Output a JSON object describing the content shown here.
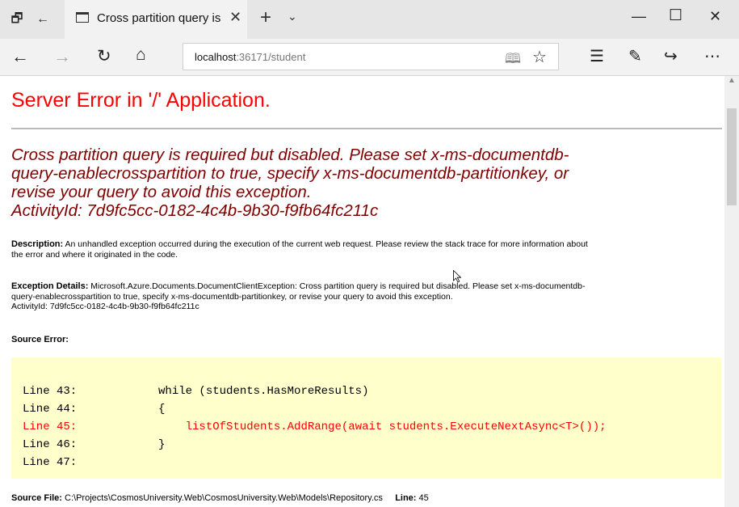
{
  "browser": {
    "tab_title": "Cross partition query is",
    "address_host": "localhost",
    "address_path": ":36171/student"
  },
  "page": {
    "title": "Server Error in '/' Application.",
    "error_heading_lines": [
      "Cross partition query is required but disabled. Please set x-ms-documentdb-",
      "query-enablecrosspartition to true, specify x-ms-documentdb-partitionkey, or",
      "revise your query to avoid this exception.",
      "ActivityId: 7d9fc5cc-0182-4c4b-9b30-f9fb64fc211c"
    ],
    "description_label": "Description:",
    "description_lines": [
      "An unhandled exception occurred during the execution of the current web request. Please review the stack trace for more information about",
      "the error and where it originated in the code."
    ],
    "exception_label": "Exception Details:",
    "exception_lines": [
      "Microsoft.Azure.Documents.DocumentClientException: Cross partition query is required but disabled. Please set x-ms-documentdb-",
      "query-enablecrosspartition to true, specify x-ms-documentdb-partitionkey, or revise your query to avoid this exception.",
      "ActivityId: 7d9fc5cc-0182-4c4b-9b30-f9fb64fc211c"
    ],
    "source_error_label": "Source Error:",
    "code_lines": [
      "Line 43:            while (students.HasMoreResults)",
      "Line 44:            {",
      "Line 45:                listOfStudents.AddRange(await students.ExecuteNextAsync<T>());",
      "Line 46:            }",
      "Line 47:"
    ],
    "source_file_label": "Source File:",
    "source_file_path": "C:\\Projects\\CosmosUniversity.Web\\CosmosUniversity.Web\\Models\\Repository.cs",
    "line_label": "Line:",
    "line_number": "45"
  },
  "colors": {
    "title_red": "#ff0000",
    "heading_maroon": "#800000",
    "code_background": "#ffffcc"
  }
}
